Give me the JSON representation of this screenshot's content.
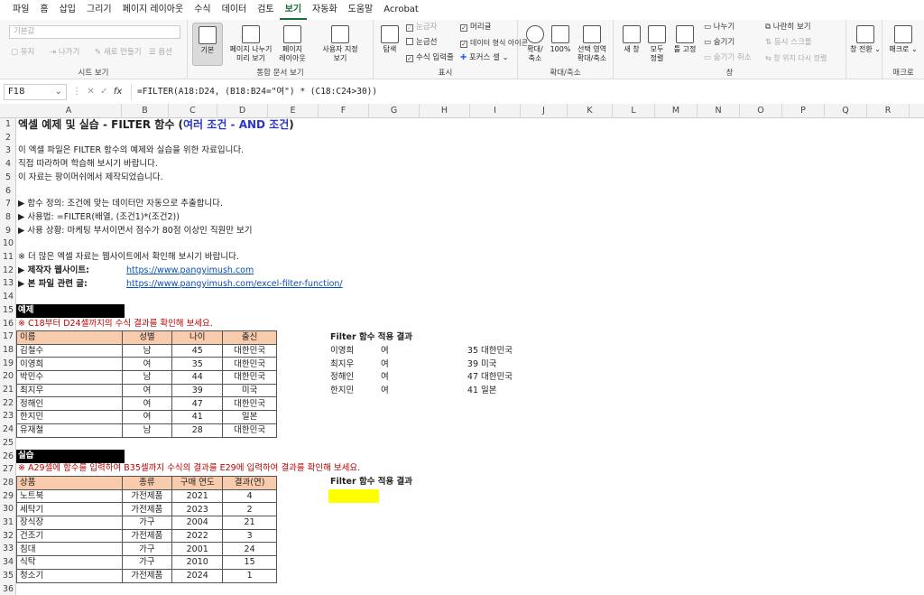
{
  "menu": [
    "파일",
    "홈",
    "삽입",
    "그리기",
    "페이지 레이아웃",
    "수식",
    "데이터",
    "검토",
    "보기",
    "자동화",
    "도움말",
    "Acrobat"
  ],
  "menu_active": "보기",
  "ribbon": {
    "sheet_view": {
      "dropdown": "기본값",
      "keep": "유지",
      "exit": "나가기",
      "new": "새로 만들기",
      "options": "옵션",
      "label": "시트 보기"
    },
    "workbook_views": {
      "normal": "기본",
      "page_break": "페이지 나누기\n미리 보기",
      "page_layout": "페이지\n레이아웃",
      "custom": "사용자 지정\n보기",
      "label": "통합 문서 보기"
    },
    "show": {
      "navigation": "탐색",
      "ruler": "눈금자",
      "gridlines": "눈금선",
      "formula_bar": "수식 입력줄",
      "headings": "머리글",
      "data_format_icons": "데이터 형식 아이콘",
      "focus_cell": "포커스 셀",
      "label": "표시"
    },
    "zoom": {
      "zoom": "확대/\n축소",
      "pct": "100%",
      "to_selection": "선택 영역\n확대/축소",
      "label": "확대/축소"
    },
    "window": {
      "new_window": "새 창",
      "arrange_all": "모두\n정렬",
      "freeze": "틀 고정",
      "split": "나누기",
      "hide": "숨기기",
      "unhide": "숨기기 취소",
      "side_by_side": "나란히 보기",
      "sync_scroll": "동시 스크롤",
      "reset_pos": "창 위치 다시 정렬",
      "switch": "창 전환",
      "label": "창"
    },
    "macros": {
      "macros": "매크로",
      "label": "매크로"
    }
  },
  "formula_bar": {
    "name_box": "F18",
    "formula": "=FILTER(A18:D24, (B18:B24=\"여\") * (C18:C24>30))"
  },
  "columns": [
    "A",
    "B",
    "C",
    "D",
    "E",
    "F",
    "G",
    "H",
    "I",
    "J",
    "K",
    "L",
    "M",
    "N",
    "O",
    "P",
    "Q",
    "R"
  ],
  "rows": [
    "1",
    "2",
    "3",
    "4",
    "5",
    "6",
    "7",
    "8",
    "9",
    "10",
    "11",
    "12",
    "13",
    "14",
    "15",
    "16",
    "17",
    "18",
    "19",
    "20",
    "21",
    "22",
    "23",
    "24",
    "25",
    "26",
    "27",
    "28",
    "29",
    "30",
    "31",
    "32",
    "33",
    "34",
    "35",
    "36"
  ],
  "sheet": {
    "title_main": "엑셀 예제 및 실습 - FILTER 함수 (",
    "title_hl": "여러 조건 - AND 조건",
    "title_end": ")",
    "intro1": "이 엑셀 파일은 FILTER 함수의 예제와 실습을 위한 자료입니다.",
    "intro2": "직접 따라하며 학습해 보시기 바랍니다.",
    "intro3": "이 자료는 팡이머쉬에서 제작되었습니다.",
    "def": "▶ 함수 정의: 조건에 맞는 데이터만 자동으로 추출합니다.",
    "usage": "▶ 사용법: =FILTER(배열, (조건1)*(조건2))",
    "situation": "▶ 사용 상황: 마케팅 부서이면서 점수가 80점 이상인 직원만 보기",
    "more": "※ 더 많은 엑셀 자료는 웹사이트에서 확인해 보시기 바랍니다.",
    "site_label": "▶ 제작자 웹사이트:",
    "site_url": "https://www.pangyimush.com",
    "file_label": "▶ 본 파일 관련 글:",
    "file_url": "https://www.pangyimush.com/excel-filter-function/",
    "example_header": "예제",
    "example_note": "※ C18부터 D24셀까지의 수식 결과를 확인해 보세요.",
    "example_cols": [
      "이름",
      "성별",
      "나이",
      "출신"
    ],
    "example_rows": [
      [
        "김철수",
        "남",
        "45",
        "대한민국"
      ],
      [
        "이영희",
        "여",
        "35",
        "대한민국"
      ],
      [
        "박민수",
        "남",
        "44",
        "대한민국"
      ],
      [
        "최지우",
        "여",
        "39",
        "미국"
      ],
      [
        "정해인",
        "여",
        "47",
        "대한민국"
      ],
      [
        "한지민",
        "여",
        "41",
        "일본"
      ],
      [
        "유재철",
        "남",
        "28",
        "대한민국"
      ]
    ],
    "result_title": "Filter 함수 적용 결과",
    "result_rows": [
      [
        "이영희",
        "여",
        "35",
        "대한민국"
      ],
      [
        "최지우",
        "여",
        "39",
        "미국"
      ],
      [
        "정해인",
        "여",
        "47",
        "대한민국"
      ],
      [
        "한지민",
        "여",
        "41",
        "일본"
      ]
    ],
    "practice_header": "실습",
    "practice_note": "※ A29셀에 함수를 입력하여 B35셀까지 수식의 결과를 E29에 입력하여 결과를 확인해 보세요.",
    "practice_cols": [
      "상품",
      "종류",
      "구매 연도",
      "결과(연)"
    ],
    "practice_rows": [
      [
        "노트북",
        "가전제품",
        "2021",
        "4"
      ],
      [
        "세탁기",
        "가전제품",
        "2023",
        "2"
      ],
      [
        "장식장",
        "가구",
        "2004",
        "21"
      ],
      [
        "건조기",
        "가전제품",
        "2022",
        "3"
      ],
      [
        "침대",
        "가구",
        "2001",
        "24"
      ],
      [
        "식탁",
        "가구",
        "2010",
        "15"
      ],
      [
        "청소기",
        "가전제품",
        "2024",
        "1"
      ]
    ],
    "practice_result_title": "Filter 함수 적용 결과"
  },
  "colors": {
    "table_header": "#f8cbad",
    "highlight": "#ffff00",
    "accent_green": "#1a6e3a",
    "title_blue": "#2a36c9",
    "note_red": "#c00000"
  }
}
